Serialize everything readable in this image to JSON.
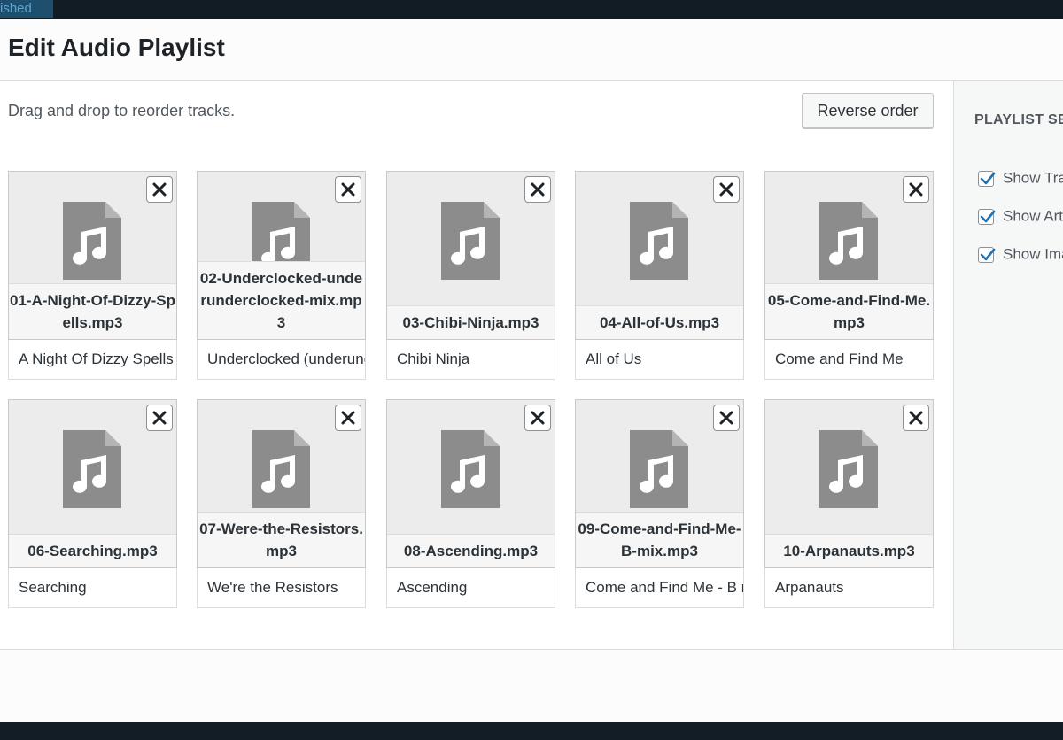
{
  "backdrop": {
    "tag_text": "ished"
  },
  "modal": {
    "title": "Edit Audio Playlist"
  },
  "toolbar": {
    "instructions": "Drag and drop to reorder tracks.",
    "reverse_label": "Reverse order"
  },
  "tracks": [
    {
      "filename": "01-A-Night-Of-Dizzy-Spells.mp3",
      "title": "A Night Of Dizzy Spells"
    },
    {
      "filename": "02-Underclocked-underunderclocked-mix.mp3",
      "title": "Underclocked (underunderclocked mix)"
    },
    {
      "filename": "03-Chibi-Ninja.mp3",
      "title": "Chibi Ninja"
    },
    {
      "filename": "04-All-of-Us.mp3",
      "title": "All of Us"
    },
    {
      "filename": "05-Come-and-Find-Me.mp3",
      "title": "Come and Find Me"
    },
    {
      "filename": "06-Searching.mp3",
      "title": "Searching"
    },
    {
      "filename": "07-Were-the-Resistors.mp3",
      "title": "We're the Resistors"
    },
    {
      "filename": "08-Ascending.mp3",
      "title": "Ascending"
    },
    {
      "filename": "09-Come-and-Find-Me-B-mix.mp3",
      "title": "Come and Find Me - B mix"
    },
    {
      "filename": "10-Arpanauts.mp3",
      "title": "Arpanauts"
    }
  ],
  "sidebar": {
    "heading": "PLAYLIST SETTINGS",
    "settings": [
      {
        "label": "Show Tracklist",
        "checked": true
      },
      {
        "label": "Show Artist Name in Tracklist",
        "checked": true
      },
      {
        "label": "Show Images",
        "checked": true
      }
    ]
  },
  "icons": {
    "file": "audio-file-icon",
    "remove": "close-icon",
    "check": "checkmark-icon"
  },
  "colors": {
    "check": "#2271b1",
    "file_icon": "#8c8c8c"
  }
}
